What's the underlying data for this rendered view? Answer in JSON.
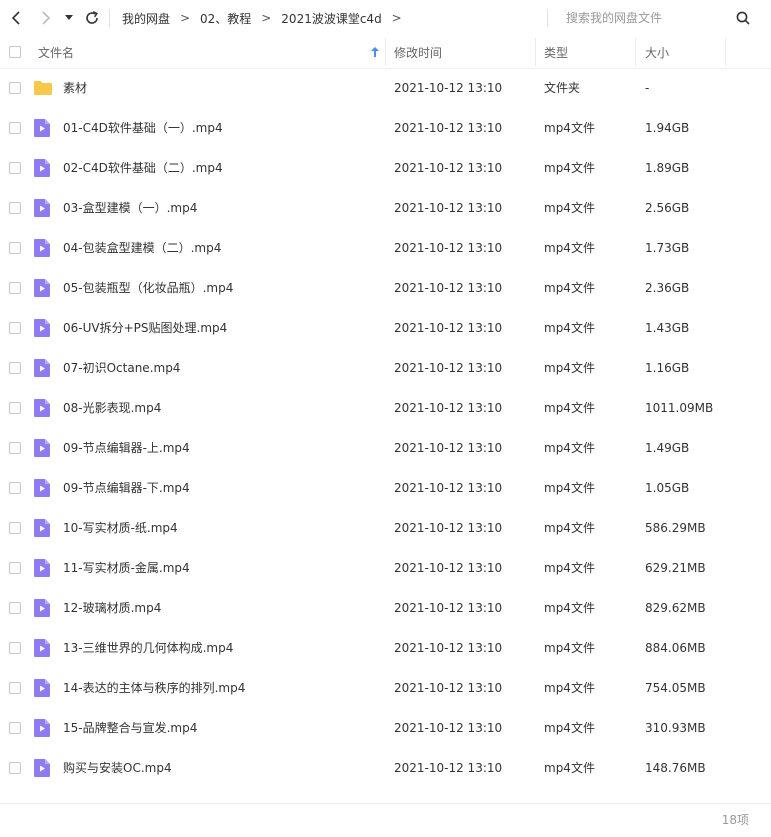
{
  "nav": {
    "breadcrumb": [
      "我的网盘",
      "02、教程",
      "2021波波课堂c4d"
    ],
    "search_placeholder": "搜索我的网盘文件"
  },
  "columns": {
    "name": "文件名",
    "modified": "修改时间",
    "type": "类型",
    "size": "大小"
  },
  "colors": {
    "folder": "#f7c94a",
    "video_icon": "#8f7cf0",
    "video_icon_fold": "#b8abf7"
  },
  "files": [
    {
      "icon": "folder-icon",
      "name": "素材",
      "modified": "2021-10-12 13:10",
      "type": "文件夹",
      "size": "-"
    },
    {
      "icon": "video-file-icon",
      "name": "01-C4D软件基础（一）.mp4",
      "modified": "2021-10-12 13:10",
      "type": "mp4文件",
      "size": "1.94GB"
    },
    {
      "icon": "video-file-icon",
      "name": "02-C4D软件基础（二）.mp4",
      "modified": "2021-10-12 13:10",
      "type": "mp4文件",
      "size": "1.89GB"
    },
    {
      "icon": "video-file-icon",
      "name": "03-盒型建模（一）.mp4",
      "modified": "2021-10-12 13:10",
      "type": "mp4文件",
      "size": "2.56GB"
    },
    {
      "icon": "video-file-icon",
      "name": "04-包装盒型建模（二）.mp4",
      "modified": "2021-10-12 13:10",
      "type": "mp4文件",
      "size": "1.73GB"
    },
    {
      "icon": "video-file-icon",
      "name": "05-包装瓶型（化妆品瓶）.mp4",
      "modified": "2021-10-12 13:10",
      "type": "mp4文件",
      "size": "2.36GB"
    },
    {
      "icon": "video-file-icon",
      "name": "06-UV拆分+PS贴图处理.mp4",
      "modified": "2021-10-12 13:10",
      "type": "mp4文件",
      "size": "1.43GB"
    },
    {
      "icon": "video-file-icon",
      "name": "07-初识Octane.mp4",
      "modified": "2021-10-12 13:10",
      "type": "mp4文件",
      "size": "1.16GB"
    },
    {
      "icon": "video-file-icon",
      "name": "08-光影表现.mp4",
      "modified": "2021-10-12 13:10",
      "type": "mp4文件",
      "size": "1011.09MB"
    },
    {
      "icon": "video-file-icon",
      "name": "09-节点编辑器-上.mp4",
      "modified": "2021-10-12 13:10",
      "type": "mp4文件",
      "size": "1.49GB"
    },
    {
      "icon": "video-file-icon",
      "name": "09-节点编辑器-下.mp4",
      "modified": "2021-10-12 13:10",
      "type": "mp4文件",
      "size": "1.05GB"
    },
    {
      "icon": "video-file-icon",
      "name": "10-写实材质-纸.mp4",
      "modified": "2021-10-12 13:10",
      "type": "mp4文件",
      "size": "586.29MB"
    },
    {
      "icon": "video-file-icon",
      "name": "11-写实材质-金属.mp4",
      "modified": "2021-10-12 13:10",
      "type": "mp4文件",
      "size": "629.21MB"
    },
    {
      "icon": "video-file-icon",
      "name": "12-玻璃材质.mp4",
      "modified": "2021-10-12 13:10",
      "type": "mp4文件",
      "size": "829.62MB"
    },
    {
      "icon": "video-file-icon",
      "name": "13-三维世界的几何体构成.mp4",
      "modified": "2021-10-12 13:10",
      "type": "mp4文件",
      "size": "884.06MB"
    },
    {
      "icon": "video-file-icon",
      "name": "14-表达的主体与秩序的排列.mp4",
      "modified": "2021-10-12 13:10",
      "type": "mp4文件",
      "size": "754.05MB"
    },
    {
      "icon": "video-file-icon",
      "name": "15-品牌整合与宣发.mp4",
      "modified": "2021-10-12 13:10",
      "type": "mp4文件",
      "size": "310.93MB"
    },
    {
      "icon": "video-file-icon",
      "name": "购买与安装OC.mp4",
      "modified": "2021-10-12 13:10",
      "type": "mp4文件",
      "size": "148.76MB"
    }
  ],
  "footer": {
    "count_label": "18项"
  }
}
